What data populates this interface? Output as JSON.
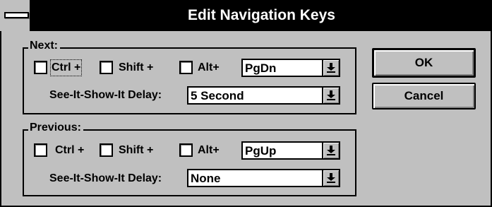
{
  "window": {
    "title": "Edit Navigation Keys"
  },
  "next": {
    "group_label": "Next:",
    "ctrl_label": "Ctrl +",
    "shift_label": "Shift +",
    "alt_label": "Alt+",
    "key_value": "PgDn",
    "delay_label": "See-It-Show-It Delay:",
    "delay_value": "5 Second"
  },
  "previous": {
    "group_label": "Previous:",
    "ctrl_label": "Ctrl +",
    "shift_label": "Shift +",
    "alt_label": "Alt+",
    "key_value": "PgUp",
    "delay_label": "See-It-Show-It Delay:",
    "delay_value": "None"
  },
  "buttons": {
    "ok_label": "OK",
    "cancel_label": "Cancel"
  }
}
